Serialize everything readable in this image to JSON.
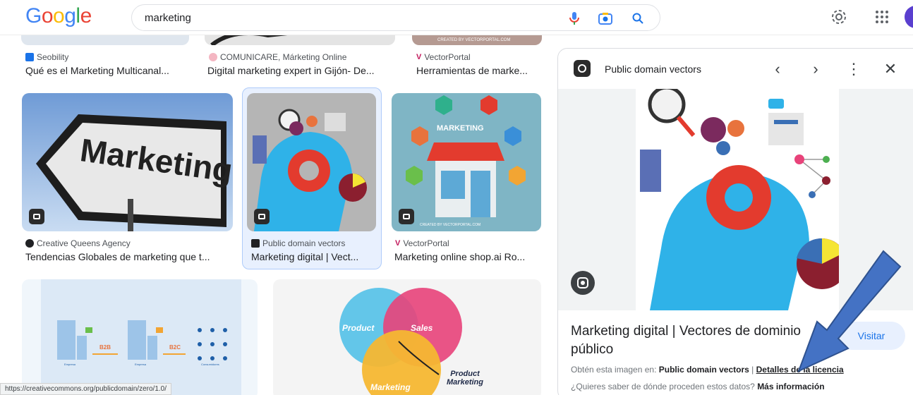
{
  "header": {
    "logo": "Google",
    "search_value": "marketing"
  },
  "results": {
    "row1": [
      {
        "source": "Seobility",
        "title": "Qué es el Marketing Multicanal...",
        "favicon_color": "#1a73e8"
      },
      {
        "source": "COMUNICARE, Márketing Online",
        "title": "Digital marketing expert in Gijón- De...",
        "favicon_color": "#f4b6c2"
      },
      {
        "source": "VectorPortal",
        "title": "Herramientas de marke...",
        "favicon_color": "#c2185b"
      }
    ],
    "row2": [
      {
        "source": "Creative Queens Agency",
        "title": "Tendencias Globales de marketing que t...",
        "image_text": "Marketing",
        "favicon_color": "#202124"
      },
      {
        "source": "Public domain vectors",
        "title": "Marketing digital | Vect...",
        "favicon_color": "#202124"
      },
      {
        "source": "VectorPortal",
        "title": "Marketing online shop.ai Ro...",
        "image_text": "MARKETING",
        "credit": "CREATED BY VECTORPORTAL.COM",
        "favicon_color": "#c2185b"
      }
    ],
    "row3": [
      {
        "labels": [
          "B2B",
          "B2C"
        ],
        "captions": [
          "Empresa",
          "Empresa",
          "Consumidores"
        ]
      },
      {
        "venn": [
          "Product",
          "Sales",
          "Marketing"
        ],
        "note": "Product Marketing"
      }
    ],
    "row1_credit": "CREATED BY VECTORPORTAL.COM"
  },
  "panel": {
    "source": "Public domain vectors",
    "title": "Marketing digital | Vectores de dominio público",
    "visit_label": "Visitar",
    "meta_prefix": "Obtén esta imagen en:",
    "meta_source": "Public domain vectors",
    "meta_separator": "|",
    "license_link": "Detalles de la licencia",
    "meta2_text": "¿Quieres saber de dónde proceden estos datos?",
    "meta2_link": "Más información",
    "prev_icon": "chevron-left-icon",
    "next_icon": "chevron-right-icon"
  },
  "status_url": "https://creativecommons.org/publicdomain/zero/1.0/",
  "colors": {
    "accent": "#1a73e8",
    "arrow": "#4472c4"
  }
}
